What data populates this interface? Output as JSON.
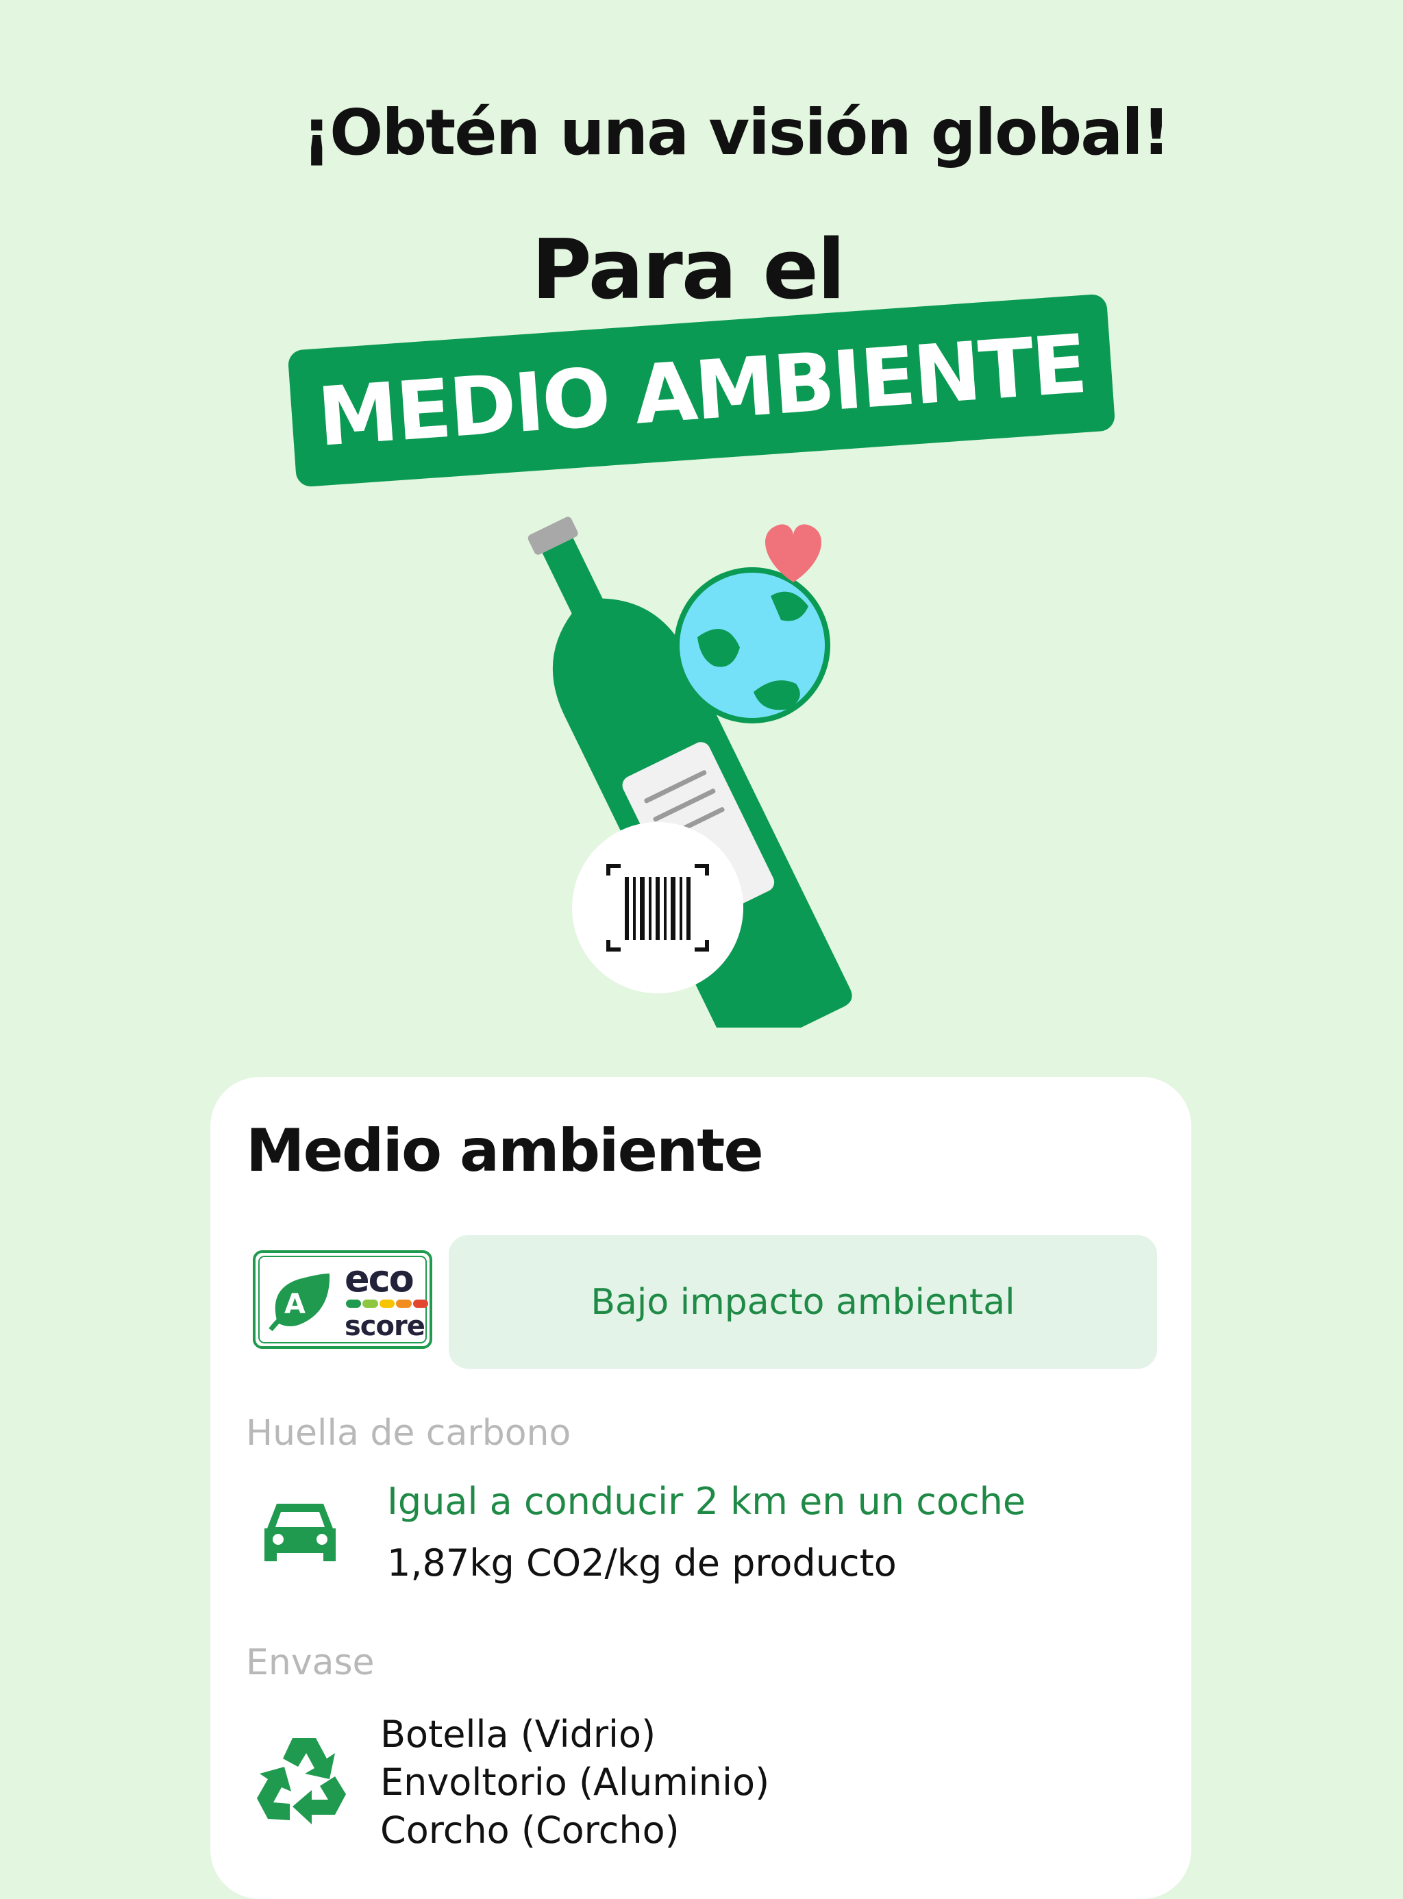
{
  "hero": {
    "line1": "¡Obtén una visión global!",
    "line2": "Para el",
    "banner": "MEDIO AMBIENTE"
  },
  "colors": {
    "background": "#e3f6df",
    "brand_green": "#0b9a53",
    "text_green": "#1f8a46",
    "pill_bg": "#e4f3e8",
    "heart": "#f0727a",
    "globe_water": "#75e1f8"
  },
  "illustration": {
    "icons": [
      "bottle-icon",
      "globe-icon",
      "heart-icon",
      "barcode-scan-icon"
    ]
  },
  "card": {
    "title": "Medio ambiente",
    "ecoscore": {
      "grade": "A",
      "word_top": "eco",
      "word_bottom": "score",
      "bar_colors": [
        "#1f9a4e",
        "#8dc63f",
        "#f6c400",
        "#f28c1e",
        "#e2462f"
      ]
    },
    "impact_label": "Bajo impacto ambiental",
    "carbon": {
      "label": "Huella de carbono",
      "icon": "car-icon",
      "equivalence": "Igual a conducir 2 km en un coche",
      "value": "1,87kg CO2/kg de producto"
    },
    "packaging": {
      "label": "Envase",
      "icon": "recycle-icon",
      "items": [
        "Botella (Vidrio)",
        "Envoltorio (Aluminio)",
        "Corcho (Corcho)"
      ]
    }
  }
}
